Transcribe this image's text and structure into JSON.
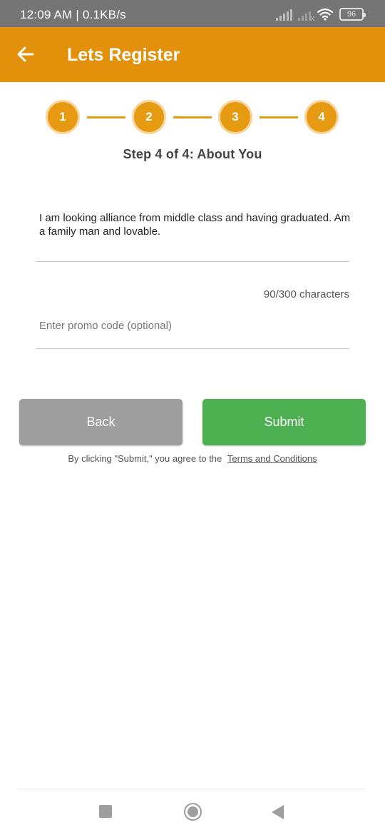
{
  "status_bar": {
    "time": "12:09 AM | 0.1KB/s",
    "battery": "96",
    "icons": [
      "signal-icon",
      "signal-x-icon",
      "wifi-icon",
      "battery-icon"
    ]
  },
  "app_bar": {
    "title": "Lets Register",
    "back_icon": "arrow-left-icon",
    "color": "#e3900b"
  },
  "stepper": {
    "steps": [
      "1",
      "2",
      "3",
      "4"
    ],
    "current": 4,
    "caption": "Step 4 of 4: About You",
    "color": "#e69a12"
  },
  "form": {
    "about_value": "I am looking alliance from middle class and having graduated. Am a family man and lovable.",
    "char_count": "90/300 characters",
    "promo_placeholder": "Enter promo code (optional)"
  },
  "buttons": {
    "back_label": "Back",
    "submit_label": "Submit",
    "back_color": "#9e9e9e",
    "submit_color": "#4caf50"
  },
  "terms": {
    "prefix": "By clicking \"Submit,\" you agree to the",
    "link": "Terms and Conditions"
  },
  "nav_bar": {
    "icons": [
      "recents-square-icon",
      "home-circle-icon",
      "back-triangle-icon"
    ]
  }
}
